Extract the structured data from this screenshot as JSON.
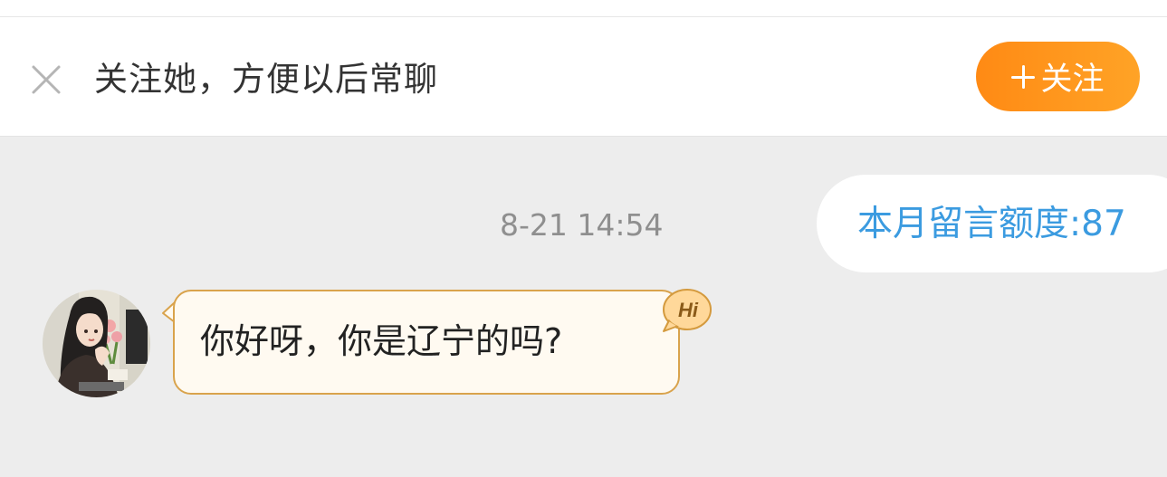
{
  "follow_bar": {
    "prompt": "关注她，方便以后常聊",
    "follow_button_label": "关注",
    "close_icon": "close-icon",
    "plus_icon": "plus-icon"
  },
  "chat": {
    "timestamp": "8-21 14:54",
    "quota_label": "本月留言额度:87",
    "messages": [
      {
        "from": "other",
        "text": "你好呀，你是辽宁的吗?",
        "badge": "Hi"
      }
    ]
  },
  "colors": {
    "accent_orange": "#ff8a14",
    "quota_blue": "#3b9be0",
    "bubble_border": "#d9a34c",
    "bubble_fill": "#fffaf1",
    "background": "#ededed"
  }
}
